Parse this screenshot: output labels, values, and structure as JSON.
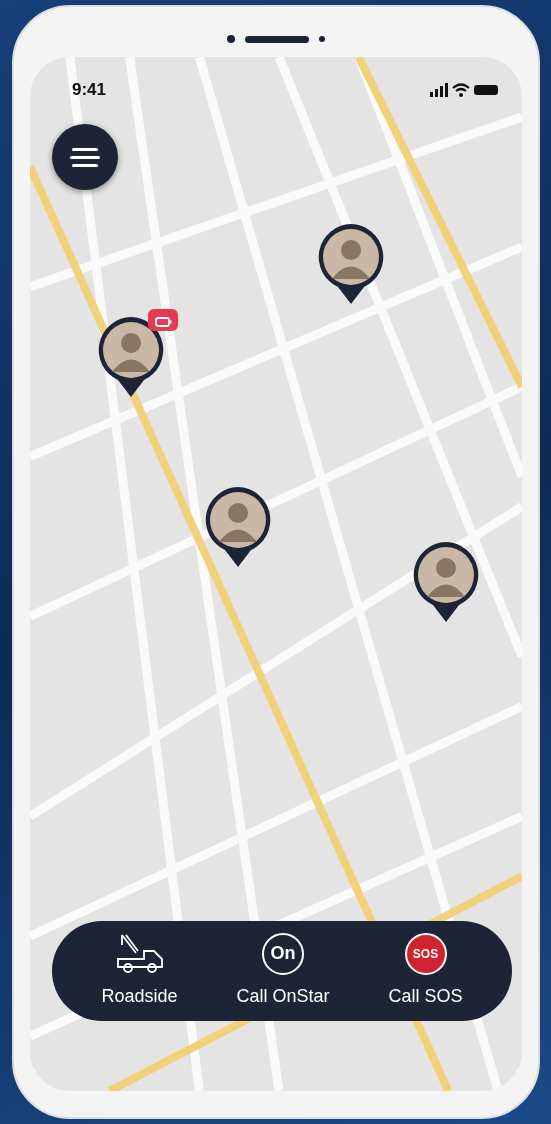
{
  "status_bar": {
    "time": "9:41"
  },
  "map": {
    "pins": [
      {
        "low_battery": false
      },
      {
        "low_battery": true
      },
      {
        "low_battery": false
      },
      {
        "low_battery": false
      }
    ]
  },
  "actions": [
    {
      "kind": "roadside",
      "label": "Roadside"
    },
    {
      "kind": "onstar",
      "label": "Call OnStar",
      "icon_text": "On"
    },
    {
      "kind": "sos",
      "label": "Call SOS",
      "icon_text": "SOS"
    }
  ]
}
